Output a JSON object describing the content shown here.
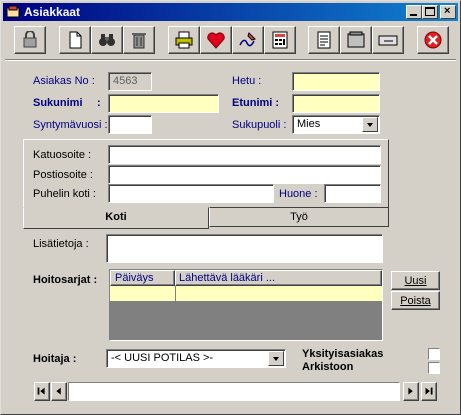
{
  "window": {
    "title": "Asiakkaat"
  },
  "form": {
    "asiakas_no_label": "Asiakas No :",
    "asiakas_no_value": "4563",
    "hetu_label": "Hetu :",
    "hetu_value": "",
    "sukunimi_label": "Sukunimi",
    "sukunimi_colon": ":",
    "sukunimi_value": "",
    "etunimi_label": "Etunimi :",
    "etunimi_value": "",
    "syntymavuosi_label": "Syntymävuosi :",
    "syntymavuosi_value": "",
    "sukupuoli_label": "Sukupuoli :",
    "sukupuoli_value": "Mies"
  },
  "address": {
    "katuosoite_label": "Katuosoite :",
    "katuosoite_value": "",
    "postiosoite_label": "Postiosoite :",
    "postiosoite_value": "",
    "puhelin_label": "Puhelin koti :",
    "puhelin_value": "",
    "huone_label": "Huone :",
    "huone_value": ""
  },
  "tabs": {
    "koti": "Koti",
    "tyo": "Työ"
  },
  "lisatietoja": {
    "label": "Lisätietoja :",
    "value": ""
  },
  "hoitosarjat": {
    "label": "Hoitosarjat :",
    "columns": [
      "Päiväys",
      "Lähettävä lääkäri ..."
    ],
    "uusi_label": "Uusi",
    "poista_label": "Poista"
  },
  "hoitaja": {
    "label": "Hoitaja :",
    "value": "-< UUSI POTILAS >-"
  },
  "flags": {
    "yksityis_label": "Yksityisasiakas",
    "arkistoon_label": "Arkistoon"
  },
  "colors": {
    "title_gradient_start": "#000080",
    "label_blue": "#000080",
    "required_field": "#ffffc0",
    "close_red": "#e02020"
  },
  "icons": {
    "toolbar": [
      "lock-icon",
      "new-document-icon",
      "binoculars-icon",
      "trash-icon",
      "print-icon",
      "heart-icon",
      "sign-icon",
      "calculator-icon",
      "notes-icon",
      "folder-icon",
      "card-icon",
      "close-icon"
    ]
  }
}
